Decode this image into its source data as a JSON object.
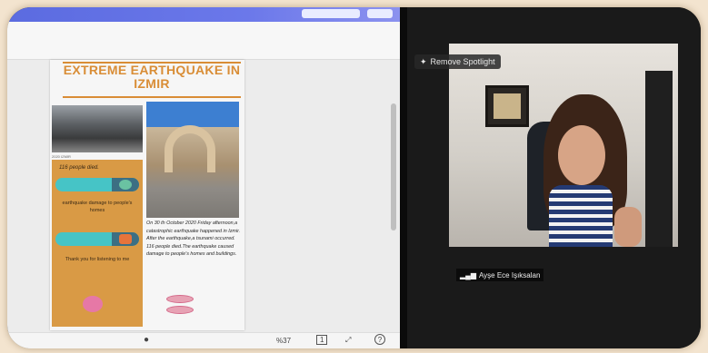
{
  "slide": {
    "title": "EXTREME EARTHQUAKE IN IZMIR",
    "photo_caption": "2020 IZMIR",
    "stat_text": "116 people died.",
    "damage_text": "earthquake damage to people's homes",
    "thanks_text": "Thank you for listening to me",
    "body_text": "On 30 th October 2020 Friday afternoon,a catastrophic earthquake happened in Izmir. After the earthquake,a tsunami occurred. 116 people died.The earthquake caused damage to people's homes and buildings."
  },
  "bottom": {
    "zoom": "%37",
    "page": "1"
  },
  "video": {
    "spotlight_label": "Remove Spotlight",
    "participant_name": "Ayşe Ece Işıksalan"
  }
}
